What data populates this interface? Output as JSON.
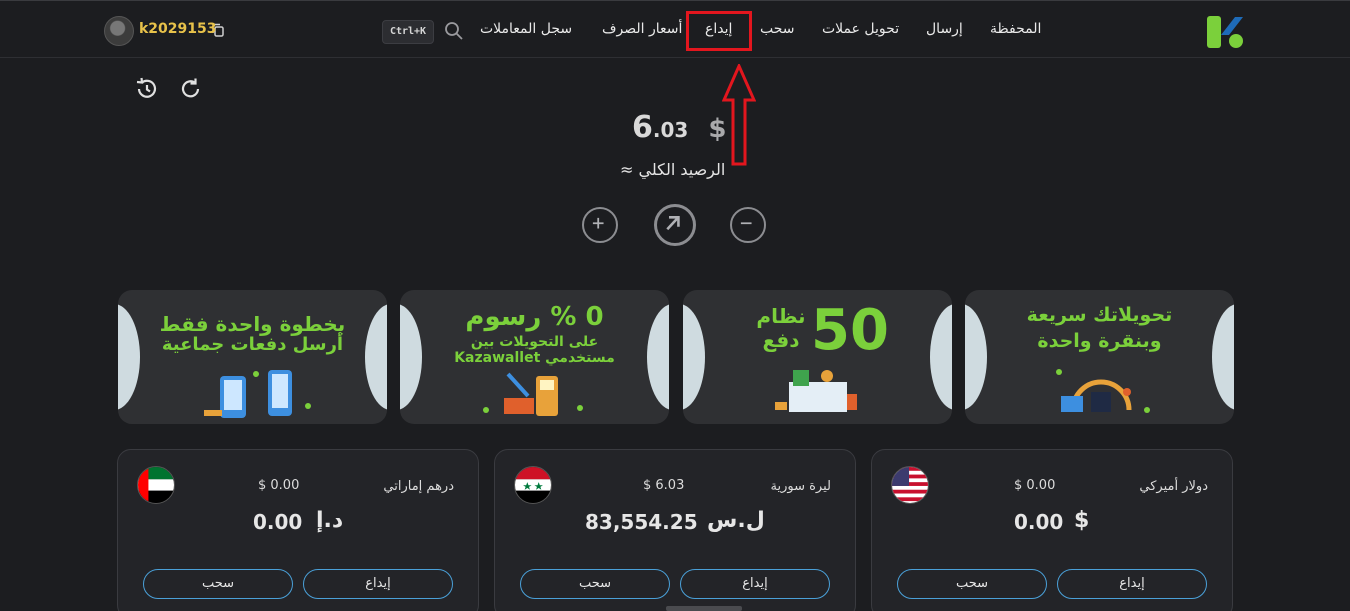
{
  "header": {
    "nav": {
      "wallet": "المحفظة",
      "send": "إرسال",
      "convert": "تحويل عملات",
      "withdraw": "سحب",
      "deposit": "إيداع",
      "rates": "أسعار الصرف",
      "history": "سجل المعاملات"
    },
    "search_shortcut": "Ctrl+K",
    "username": "k2029153"
  },
  "balance": {
    "currency": "$",
    "integer": "6",
    "decimal": ".03",
    "label": "الرصيد الكلي ≈"
  },
  "banners": [
    {
      "title": "تحويلاتك سريعة وبنقرة واحدة"
    },
    {
      "number": "50",
      "title": "نظام دفع"
    },
    {
      "title": "0 % رسوم",
      "subtitle": "على التحويلات بين مستخدمي Kazawallet"
    },
    {
      "title": "بخطوة واحدة فقط",
      "subtitle": "أرسل دفعات جماعية"
    }
  ],
  "cards": [
    {
      "name": "دولار أميركي",
      "usd": "$ 0.00",
      "symbol": "$",
      "amount": "0.00",
      "deposit": "إيداع",
      "withdraw": "سحب"
    },
    {
      "name": "ليرة سورية",
      "usd": "$ 6.03",
      "symbol": "ل.س",
      "amount": "83,554.25",
      "deposit": "إيداع",
      "withdraw": "سحب"
    },
    {
      "name": "درهم إماراتي",
      "usd": "$ 0.00",
      "symbol": "د.إ",
      "amount": "0.00",
      "deposit": "إيداع",
      "withdraw": "سحب"
    }
  ],
  "colors": {
    "accent_green": "#7bd03b",
    "highlight_red": "#e3161e",
    "pill_border": "#4aa0d8",
    "username": "#e8c24a"
  },
  "icons": [
    "logo-icon",
    "search-icon",
    "copy-icon",
    "history-icon",
    "refresh-icon",
    "plus-icon",
    "transfer-icon",
    "minus-icon",
    "arrow-up-annotation"
  ]
}
